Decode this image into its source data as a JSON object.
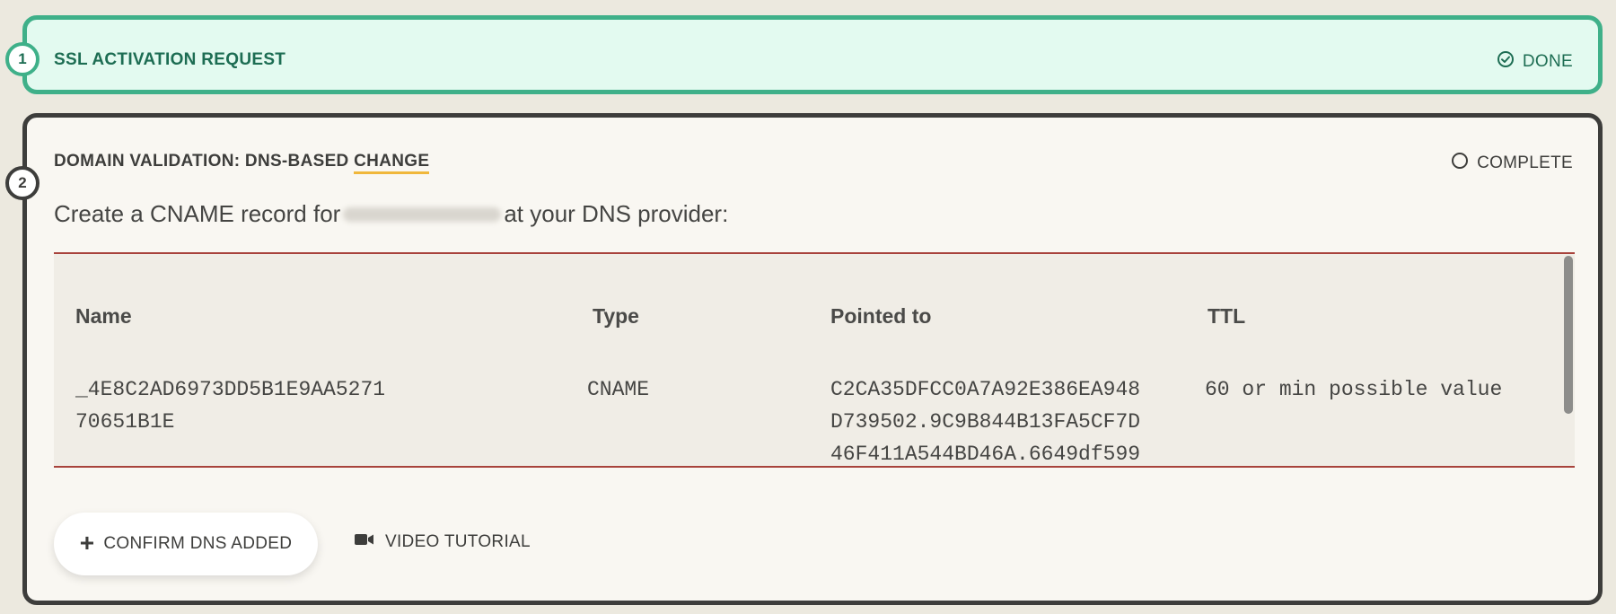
{
  "step1": {
    "number": "1",
    "title": "SSL ACTIVATION REQUEST",
    "status": "DONE"
  },
  "step2": {
    "number": "2",
    "title_prefix": "DOMAIN VALIDATION: DNS-BASED ",
    "title_accent": "CHANGE",
    "status": "COMPLETE",
    "instruction_before": "Create a CNAME record for",
    "instruction_after": "at your DNS provider:",
    "table": {
      "headers": [
        "Name",
        "Type",
        "Pointed to",
        "TTL"
      ],
      "row": {
        "name": "_4E8C2AD6973DD5B1E9AA5271\n70651B1E",
        "type": "CNAME",
        "pointed_to": "C2CA35DFCC0A7A92E386EA948\nD739502.9C9B844B13FA5CF7D\n46F411A544BD46A.6649df599",
        "ttl": "60 or min possible value"
      }
    },
    "confirm_label": "CONFIRM DNS ADDED",
    "video_label": "VIDEO TUTORIAL"
  },
  "colors": {
    "done_green": "#3fb089",
    "active_dark": "#3d3d3b",
    "table_border": "#a8433c",
    "accent_underline": "#f0b73b"
  }
}
